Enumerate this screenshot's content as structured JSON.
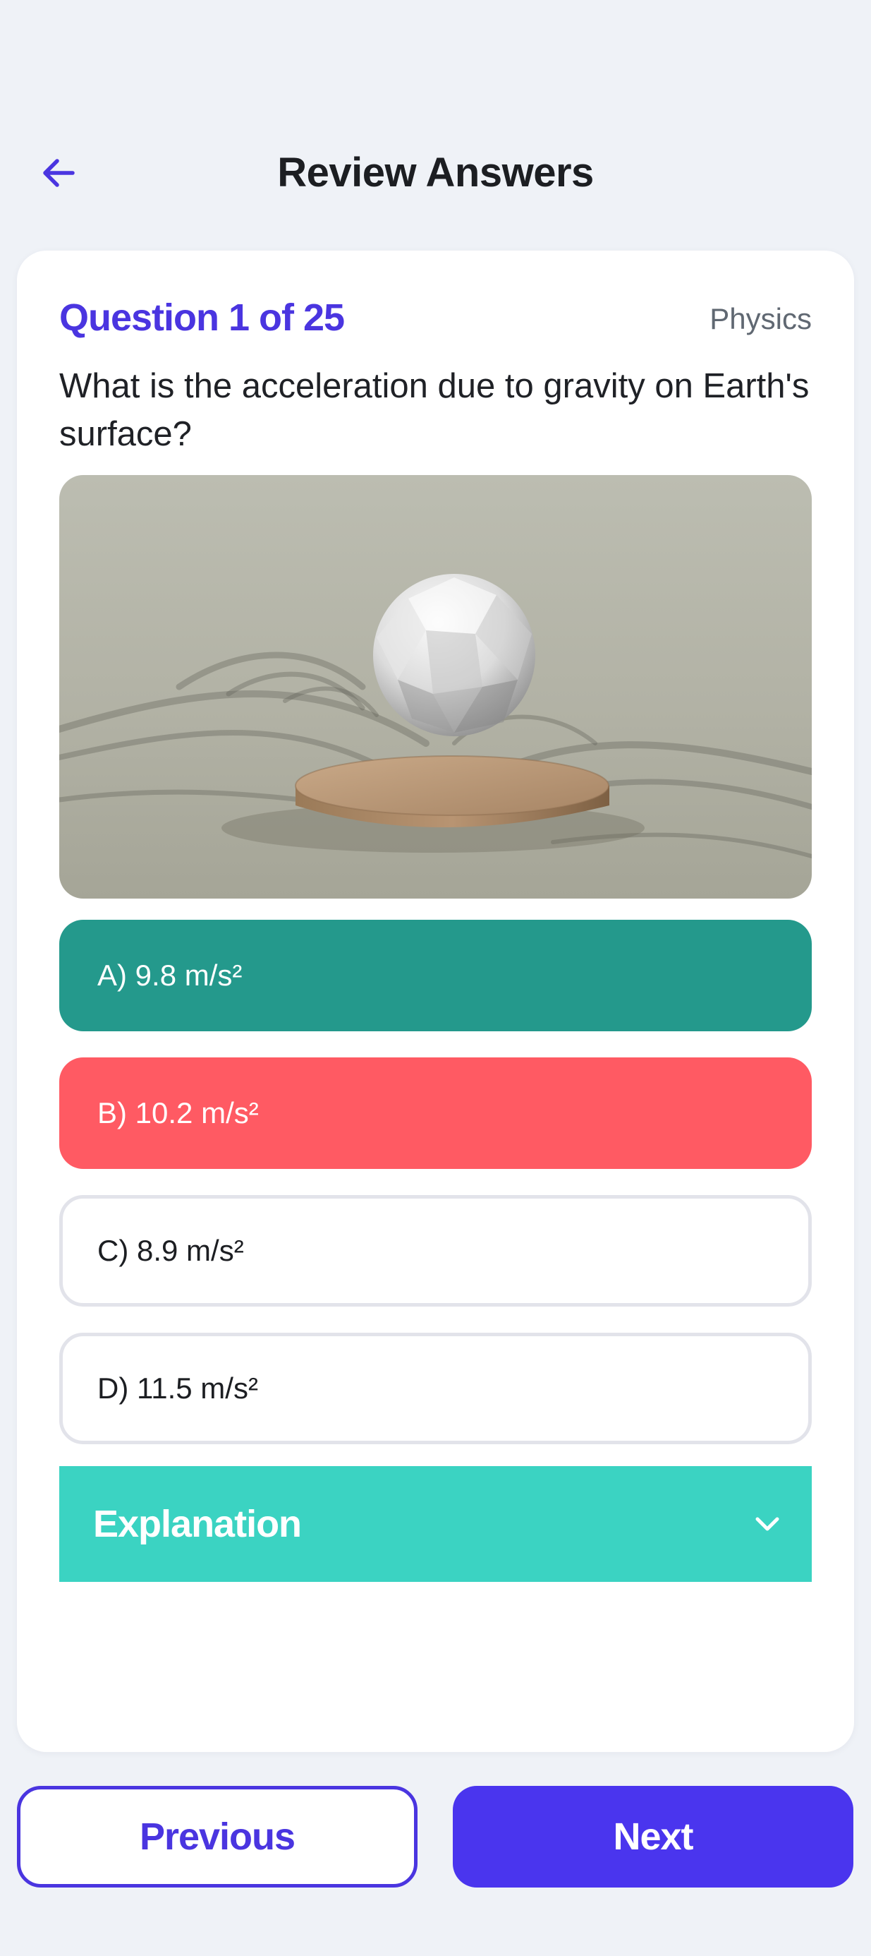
{
  "header": {
    "title": "Review Answers",
    "back_icon": "arrow-left-icon"
  },
  "question": {
    "number_label": "Question 1 of 25",
    "subject": "Physics",
    "text": "What is the acceleration due to gravity on Earth's surface?",
    "image_alt": "Sphere floating above a wooden base"
  },
  "options": [
    {
      "label": "A) 9.8 m/s²",
      "state": "correct"
    },
    {
      "label": "B) 10.2 m/s²",
      "state": "incorrect"
    },
    {
      "label": "C) 8.9 m/s²",
      "state": "unselected"
    },
    {
      "label": "D) 11.5 m/s²",
      "state": "unselected"
    }
  ],
  "explanation": {
    "label": "Explanation",
    "icon": "chevron-down-icon",
    "expanded": false
  },
  "navigation": {
    "previous_label": "Previous",
    "next_label": "Next"
  },
  "colors": {
    "accent": "#4a35e0",
    "correct": "#24998c",
    "incorrect": "#ff5a63",
    "explanation": "#3bd3c2",
    "background": "#eff2f7"
  }
}
